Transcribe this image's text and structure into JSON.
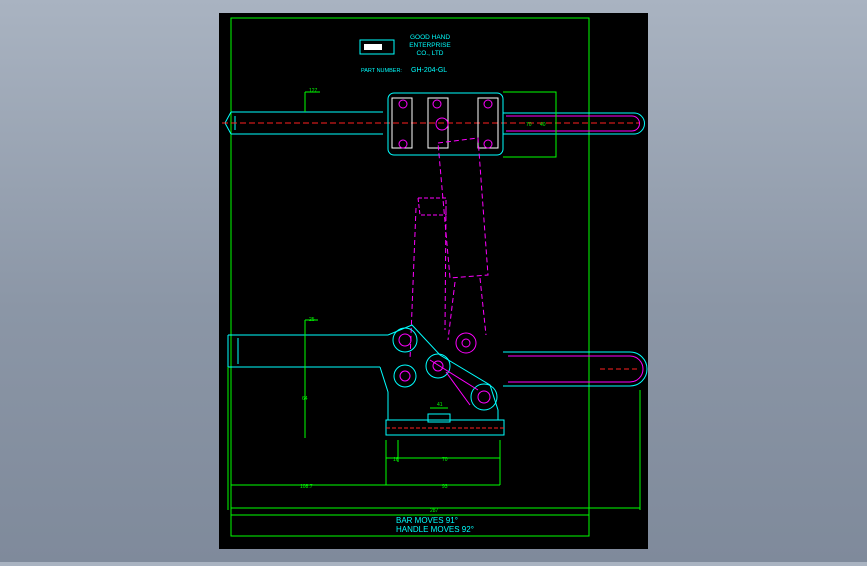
{
  "title_block": {
    "company_line1": "GOOD HAND",
    "company_line2": "ENTERPRISE",
    "company_line3": "CO., LTD",
    "part_number_label": "PART NUMBER:",
    "part_number_value": "GH-204-GL"
  },
  "dimensions": {
    "d_top_left": "127",
    "d_top_mid": "70",
    "d_top_right": "40",
    "d_mid_left": "25",
    "d_height": "64",
    "d_small": "41",
    "d_base_left": "16",
    "d_base_span": "70",
    "d_lower_left": "108.7",
    "d_lower_mid": "93",
    "d_overall": "287"
  },
  "notes": {
    "bar_moves": "BAR MOVES 91°",
    "handle_moves": "HANDLE MOVES 92°"
  },
  "colors": {
    "background": "#a9b3c1",
    "sheet": "#000000",
    "cyan": "#00ffff",
    "magenta": "#ff00ff",
    "green": "#00ff00",
    "red": "#ff2020",
    "white": "#ffffff",
    "yellow": "#ffff00"
  }
}
